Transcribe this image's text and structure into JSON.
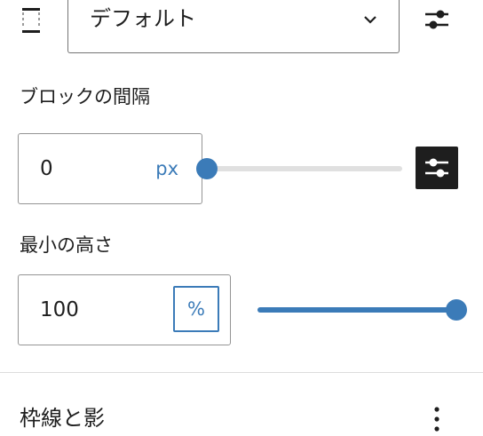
{
  "layout_control": {
    "icon": "padding-sides-icon",
    "select_value": "デフォルト",
    "chevron_icon": "chevron-down-icon",
    "settings_icon": "sliders-icon"
  },
  "block_spacing": {
    "label": "ブロックの間隔",
    "value": "0",
    "unit": "px",
    "slider_fraction": 0,
    "settings_icon": "sliders-icon"
  },
  "min_height": {
    "label": "最小の高さ",
    "value": "100",
    "unit": "%",
    "slider_fraction": 1
  },
  "border_section": {
    "title": "枠線と影",
    "menu_icon": "kebab-menu-icon"
  },
  "colors": {
    "accent": "#3b7bb8",
    "dark": "#1e1e1e",
    "track": "#e0e0e0"
  }
}
